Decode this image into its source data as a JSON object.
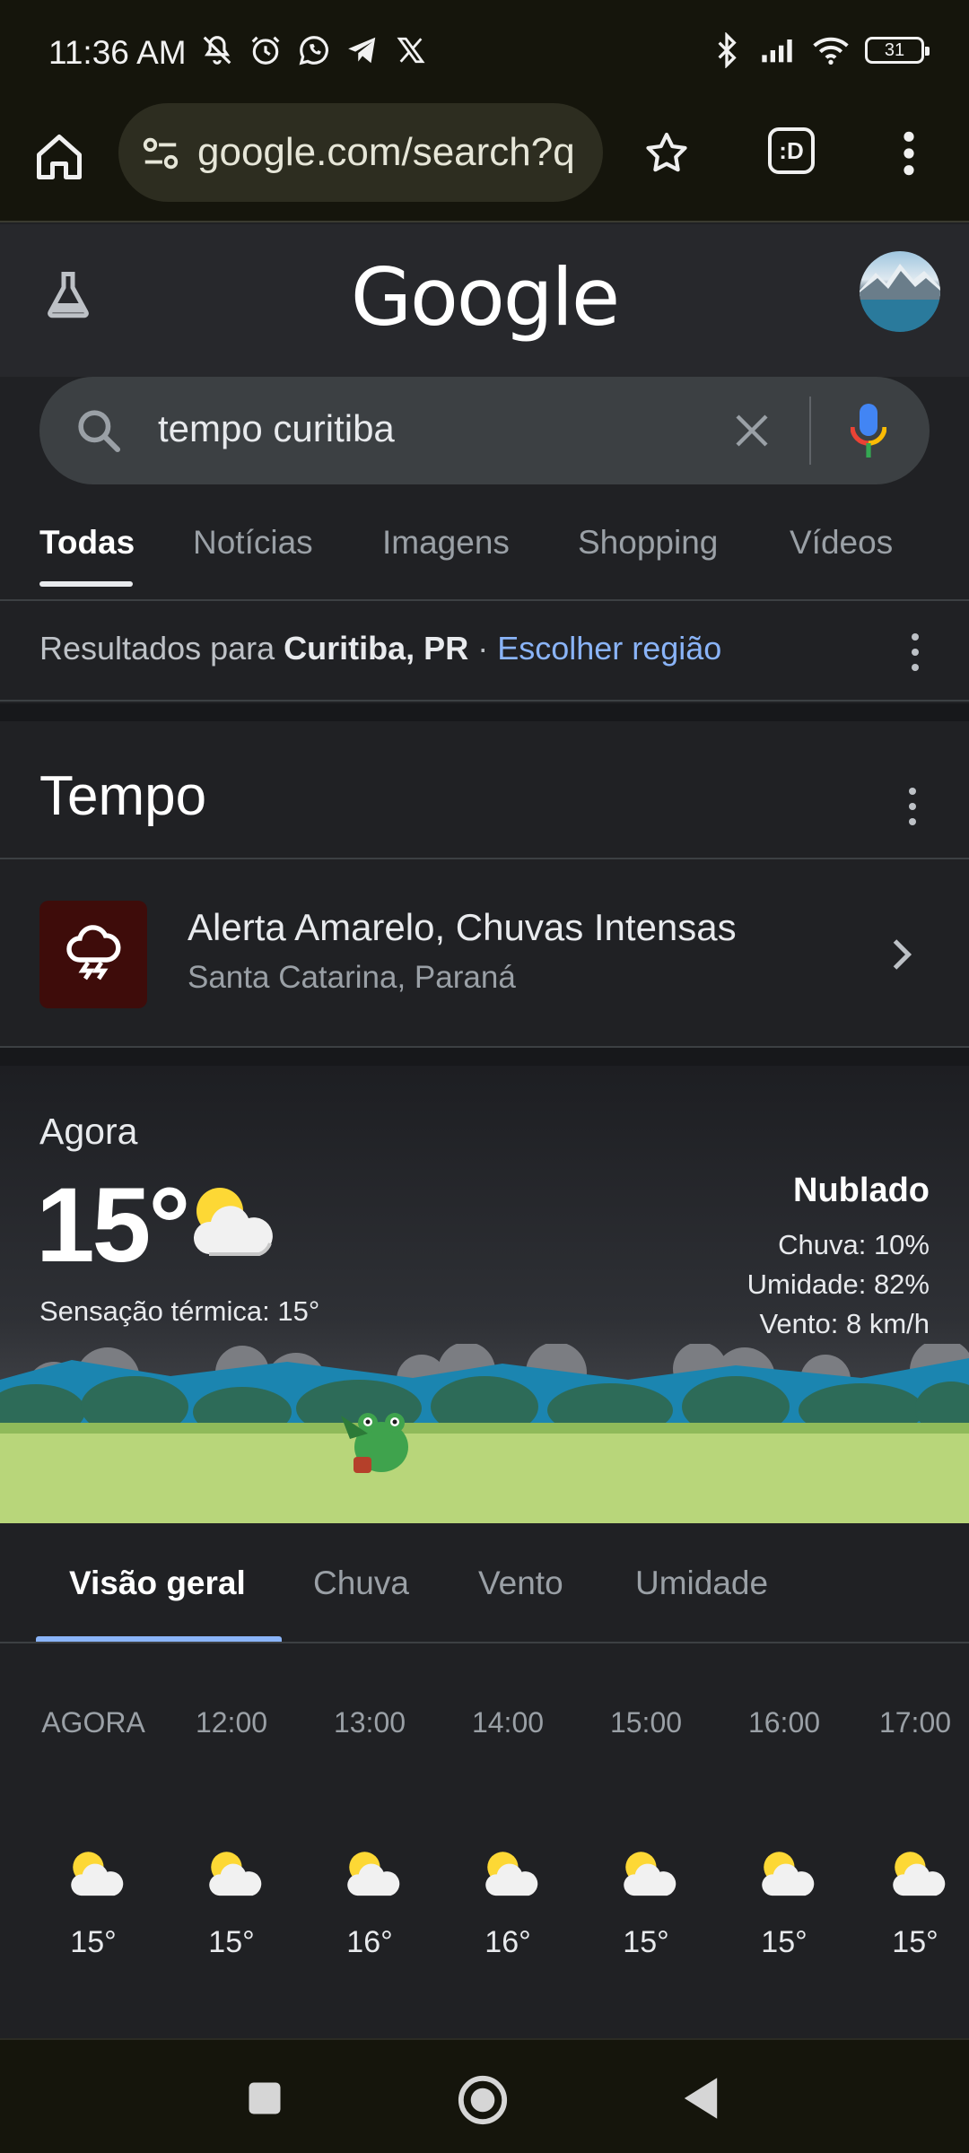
{
  "status_bar": {
    "time": "11:36 AM",
    "battery": "31",
    "icons_left": [
      "mute-icon",
      "alarm-icon",
      "whatsapp-icon",
      "telegram-icon",
      "x-icon"
    ],
    "icons_right": [
      "bluetooth-icon",
      "signal-icon",
      "wifi-icon",
      "battery-icon"
    ]
  },
  "browser": {
    "url": "google.com/search?q",
    "tabs_label": ":D"
  },
  "search": {
    "query": "tempo curitiba"
  },
  "tabs": [
    "Todas",
    "Notícias",
    "Imagens",
    "Shopping",
    "Vídeos"
  ],
  "region": {
    "prefix": "Resultados para ",
    "location": "Curitiba, PR",
    "separator": " · ",
    "link": "Escolher região"
  },
  "weather": {
    "section_title": "Tempo",
    "alert": {
      "title": "Alerta Amarelo, Chuvas Intensas",
      "subtitle": "Santa Catarina, Paraná"
    },
    "now": {
      "label": "Agora",
      "temp": "15°",
      "feels_like": "Sensação térmica: 15°",
      "condition": "Nublado",
      "rain": "Chuva: 10%",
      "humidity": "Umidade: 82%",
      "wind": "Vento: 8 km/h"
    },
    "subtabs": [
      "Visão geral",
      "Chuva",
      "Vento",
      "Umidade"
    ],
    "hourly": [
      {
        "time": "AGORA",
        "temp": "15°"
      },
      {
        "time": "12:00",
        "temp": "15°"
      },
      {
        "time": "13:00",
        "temp": "16°"
      },
      {
        "time": "14:00",
        "temp": "16°"
      },
      {
        "time": "15:00",
        "temp": "15°"
      },
      {
        "time": "16:00",
        "temp": "15°"
      },
      {
        "time": "17:00",
        "temp": "15°"
      }
    ]
  },
  "colors": {
    "accent_blue": "#8ab4f8",
    "sun_yellow": "#fdd835",
    "alert_bg": "#3e0c0a"
  }
}
